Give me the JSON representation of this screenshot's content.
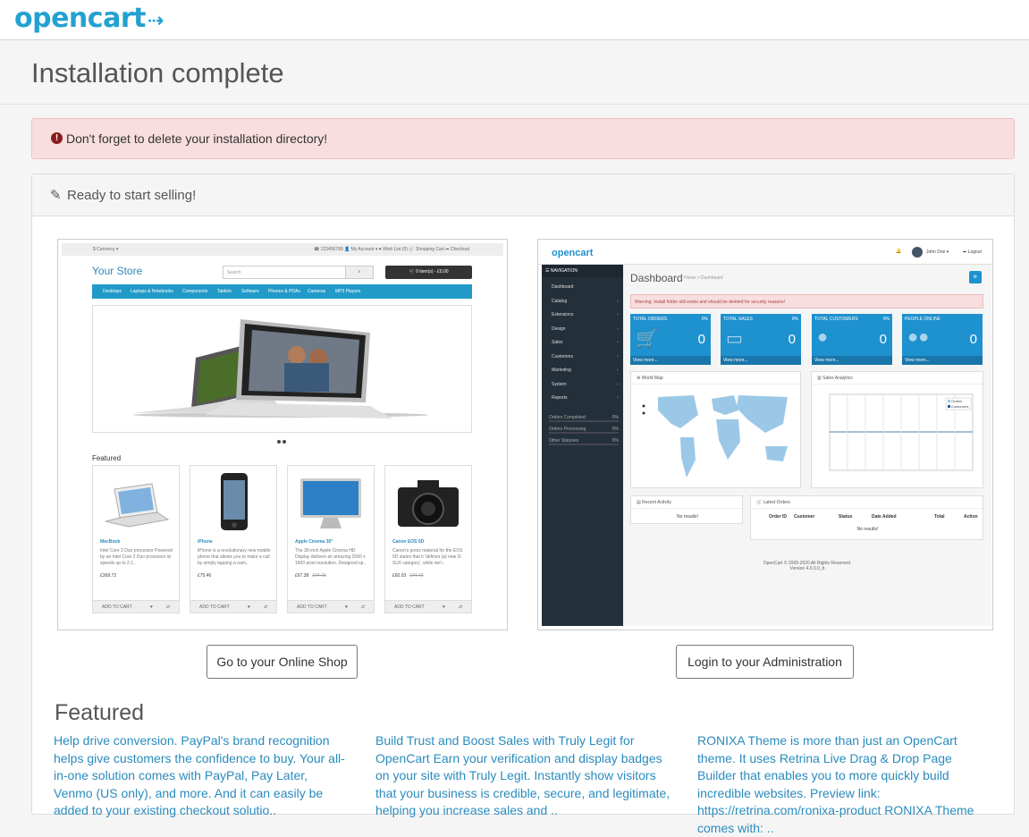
{
  "header": {
    "logo_text": "opencart",
    "logo_cart": ".: "
  },
  "page": {
    "title": "Installation complete"
  },
  "alert": {
    "icon": "exclamation-circle-icon",
    "text": "Don't forget to delete your installation directory!"
  },
  "panel": {
    "icon": "pencil-icon",
    "heading": "Ready to start selling!"
  },
  "buttons": {
    "shop": "Go to your Online Shop",
    "admin": "Login to your Administration"
  },
  "featured": {
    "title": "Featured",
    "items": [
      {
        "text": "Help drive conversion. PayPal's brand recognition helps give customers the confidence to buy. Your all-in-one solution comes with PayPal, Pay Later, Venmo (US only), and more. And it can easily be added to your existing checkout solutio.."
      },
      {
        "text": "Build Trust and Boost Sales with Truly Legit for OpenCart Earn your verification and display badges on your site with Truly Legit. Instantly show visitors that your business is credible, secure, and legitimate, helping you increase sales and .."
      },
      {
        "text": "RONIXA Theme is more than just an OpenCart theme. It uses Retrina Live Drag & Drop Page Builder that enables you to more quickly build incredible websites. Preview link: https://retrina.com/ronixa-product RONIXA Theme comes with: .."
      }
    ]
  },
  "shop_preview": {
    "currency": "$ Currency ▾",
    "topbar_right": "☎ 123456789   👤 My Account ▾   ♥ Wish List (0)   🛒 Shopping Cart   ➦ Checkout",
    "store_name": "Your Store",
    "search_placeholder": "Search",
    "cart": "🛒 0 item(s) - £0.00",
    "nav": [
      "Desktops",
      "Laptops & Notebooks",
      "Components",
      "Tablets",
      "Software",
      "Phones & PDAs",
      "Cameras",
      "MP3 Players"
    ],
    "featured_label": "Featured",
    "add_to_cart": "ADD TO CART",
    "products": [
      {
        "name": "MacBook",
        "desc": "Intel Core 2 Duo processor Powered by an Intel Core 2 Duo processor at speeds up to 2.1..",
        "price": "£368.73",
        "old": ""
      },
      {
        "name": "iPhone",
        "desc": "iPhone is a revolutionary new mobile phone that allows you to make a call by simply tapping a nam..",
        "price": "£75.46",
        "old": ""
      },
      {
        "name": "Apple Cinema 30\"",
        "desc": "The 30-inch Apple Cinema HD Display delivers an amazing 2560 x 1600 pixel resolution. Designed sp..",
        "price": "£67.38",
        "old": "£74.73"
      },
      {
        "name": "Canon EOS 5D",
        "desc": "Canon's press material for the EOS 5D states that it 'defines (a) new D-SLR category', while we'r..",
        "price": "£60.03",
        "old": "£74.73"
      }
    ]
  },
  "admin_preview": {
    "logo": "opencart",
    "user": "John Doe ▾",
    "logout": "Logout",
    "nav_header": "☰ NAVIGATION",
    "nav": [
      "Dashboard",
      "Catalog",
      "Extensions",
      "Design",
      "Sales",
      "Customers",
      "Marketing",
      "System",
      "Reports"
    ],
    "stats": [
      {
        "label": "Orders Completed",
        "pct": "0%"
      },
      {
        "label": "Orders Processing",
        "pct": "0%"
      },
      {
        "label": "Other Statuses",
        "pct": "0%"
      }
    ],
    "title": "Dashboard",
    "breadcrumb": "Home > Dashboard",
    "warning": "Warning: Install folder still exists and should be deleted for security reasons!",
    "tiles": [
      {
        "label": "TOTAL ORDERS",
        "pct": "0%",
        "value": "0",
        "more": "View more..."
      },
      {
        "label": "TOTAL SALES",
        "pct": "0%",
        "value": "0",
        "more": "View more..."
      },
      {
        "label": "TOTAL CUSTOMERS",
        "pct": "0%",
        "value": "0",
        "more": "View more..."
      },
      {
        "label": "PEOPLE ONLINE",
        "pct": "",
        "value": "0",
        "more": "View more..."
      }
    ],
    "world_map": "World Map",
    "sales_analytics": "Sales Analytics",
    "legend": [
      "Orders",
      "Customers"
    ],
    "recent_activity": "Recent Activity",
    "latest_orders": "Latest Orders",
    "no_results": "No results!",
    "orders_cols": [
      "Order ID",
      "Customer",
      "Status",
      "Date Added",
      "Total",
      "Action"
    ],
    "footer1": "OpenCart © 2009-2020 All Rights Reserved.",
    "footer2": "Version 4.0.0.0_b"
  },
  "colors": {
    "brand": "#23a1d1",
    "alert_bg": "#f8dede",
    "link": "#2a8bbd"
  }
}
